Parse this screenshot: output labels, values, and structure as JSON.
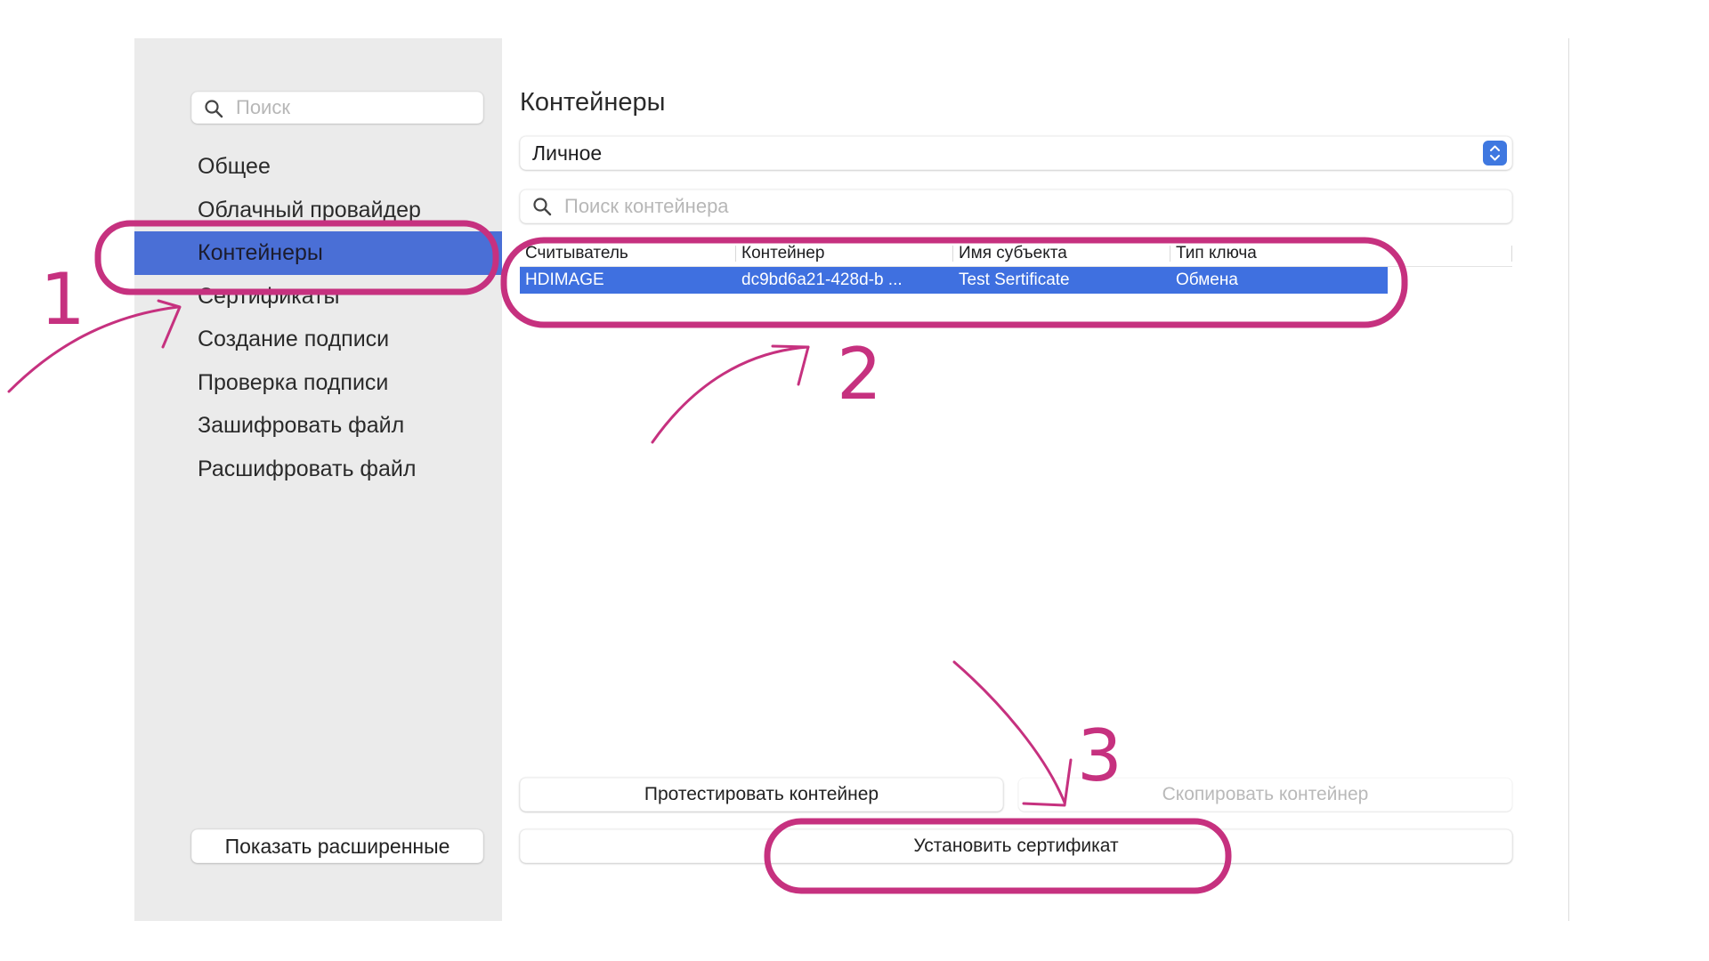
{
  "sidebar": {
    "search_placeholder": "Поиск",
    "items": [
      {
        "label": "Общее"
      },
      {
        "label": "Облачный провайдер"
      },
      {
        "label": "Контейнеры",
        "active": true
      },
      {
        "label": "Сертификаты"
      },
      {
        "label": "Создание подписи"
      },
      {
        "label": "Проверка подписи"
      },
      {
        "label": "Зашифровать файл"
      },
      {
        "label": "Расшифровать файл"
      }
    ],
    "show_advanced_label": "Показать расширенные"
  },
  "main": {
    "title": "Контейнеры",
    "store_select": {
      "value": "Личное"
    },
    "container_search_placeholder": "Поиск контейнера",
    "table": {
      "columns": [
        "Считыватель",
        "Контейнер",
        "Имя субъекта",
        "Тип ключа"
      ],
      "rows": [
        {
          "reader": "HDIMAGE",
          "container": "dc9bd6a21-428d-b ...",
          "subject": "Test Sertificate",
          "key_type": "Обмена",
          "selected": true
        }
      ]
    },
    "buttons": {
      "test_container": "Протестировать контейнер",
      "copy_container": "Скопировать контейнер",
      "install_certificate": "Установить сертификат"
    }
  },
  "annotations": {
    "step_numbers": [
      "1",
      "2",
      "3"
    ],
    "color": "#c6317f"
  },
  "colors": {
    "accent": "#3f70e0",
    "sidebar_bg": "#ebebeb",
    "annotation": "#c6317f"
  },
  "icons": [
    "search-icon",
    "chevron-up-down-icon"
  ]
}
